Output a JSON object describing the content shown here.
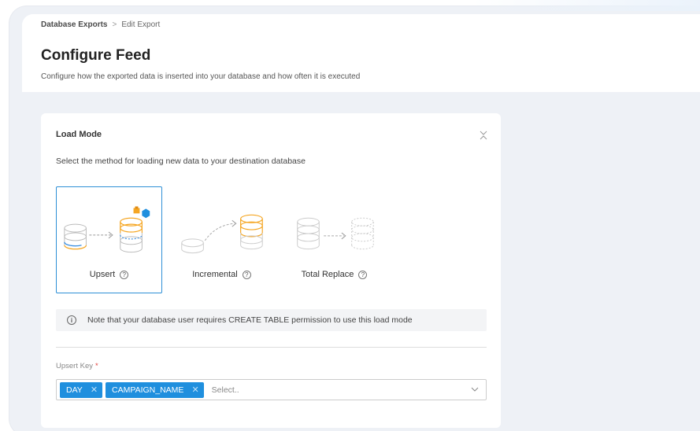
{
  "breadcrumb": {
    "parent": "Database Exports",
    "current": "Edit Export"
  },
  "page": {
    "title": "Configure Feed",
    "subtitle": "Configure how the exported data is inserted into your database and how often it is executed"
  },
  "load_mode": {
    "title": "Load Mode",
    "description": "Select the method for loading new data to your destination database",
    "options": [
      {
        "label": "Upsert",
        "selected": true
      },
      {
        "label": "Incremental",
        "selected": false
      },
      {
        "label": "Total Replace",
        "selected": false
      }
    ],
    "note": "Note that your database user requires CREATE TABLE permission to use this load mode"
  },
  "upsert_key": {
    "label": "Upsert Key",
    "required_mark": "*",
    "tags": [
      "DAY",
      "CAMPAIGN_NAME"
    ],
    "placeholder": "Select.."
  },
  "colors": {
    "accent": "#2d8fd6",
    "tag_bg": "#1f8fde",
    "required": "#e0403a",
    "db_orange": "#f5a623",
    "db_blue": "#3b8fe0"
  },
  "icons": [
    "chevron-right-icon",
    "collapse-icon",
    "help-icon",
    "info-icon",
    "close-icon",
    "chevron-down-icon",
    "database-icon"
  ]
}
